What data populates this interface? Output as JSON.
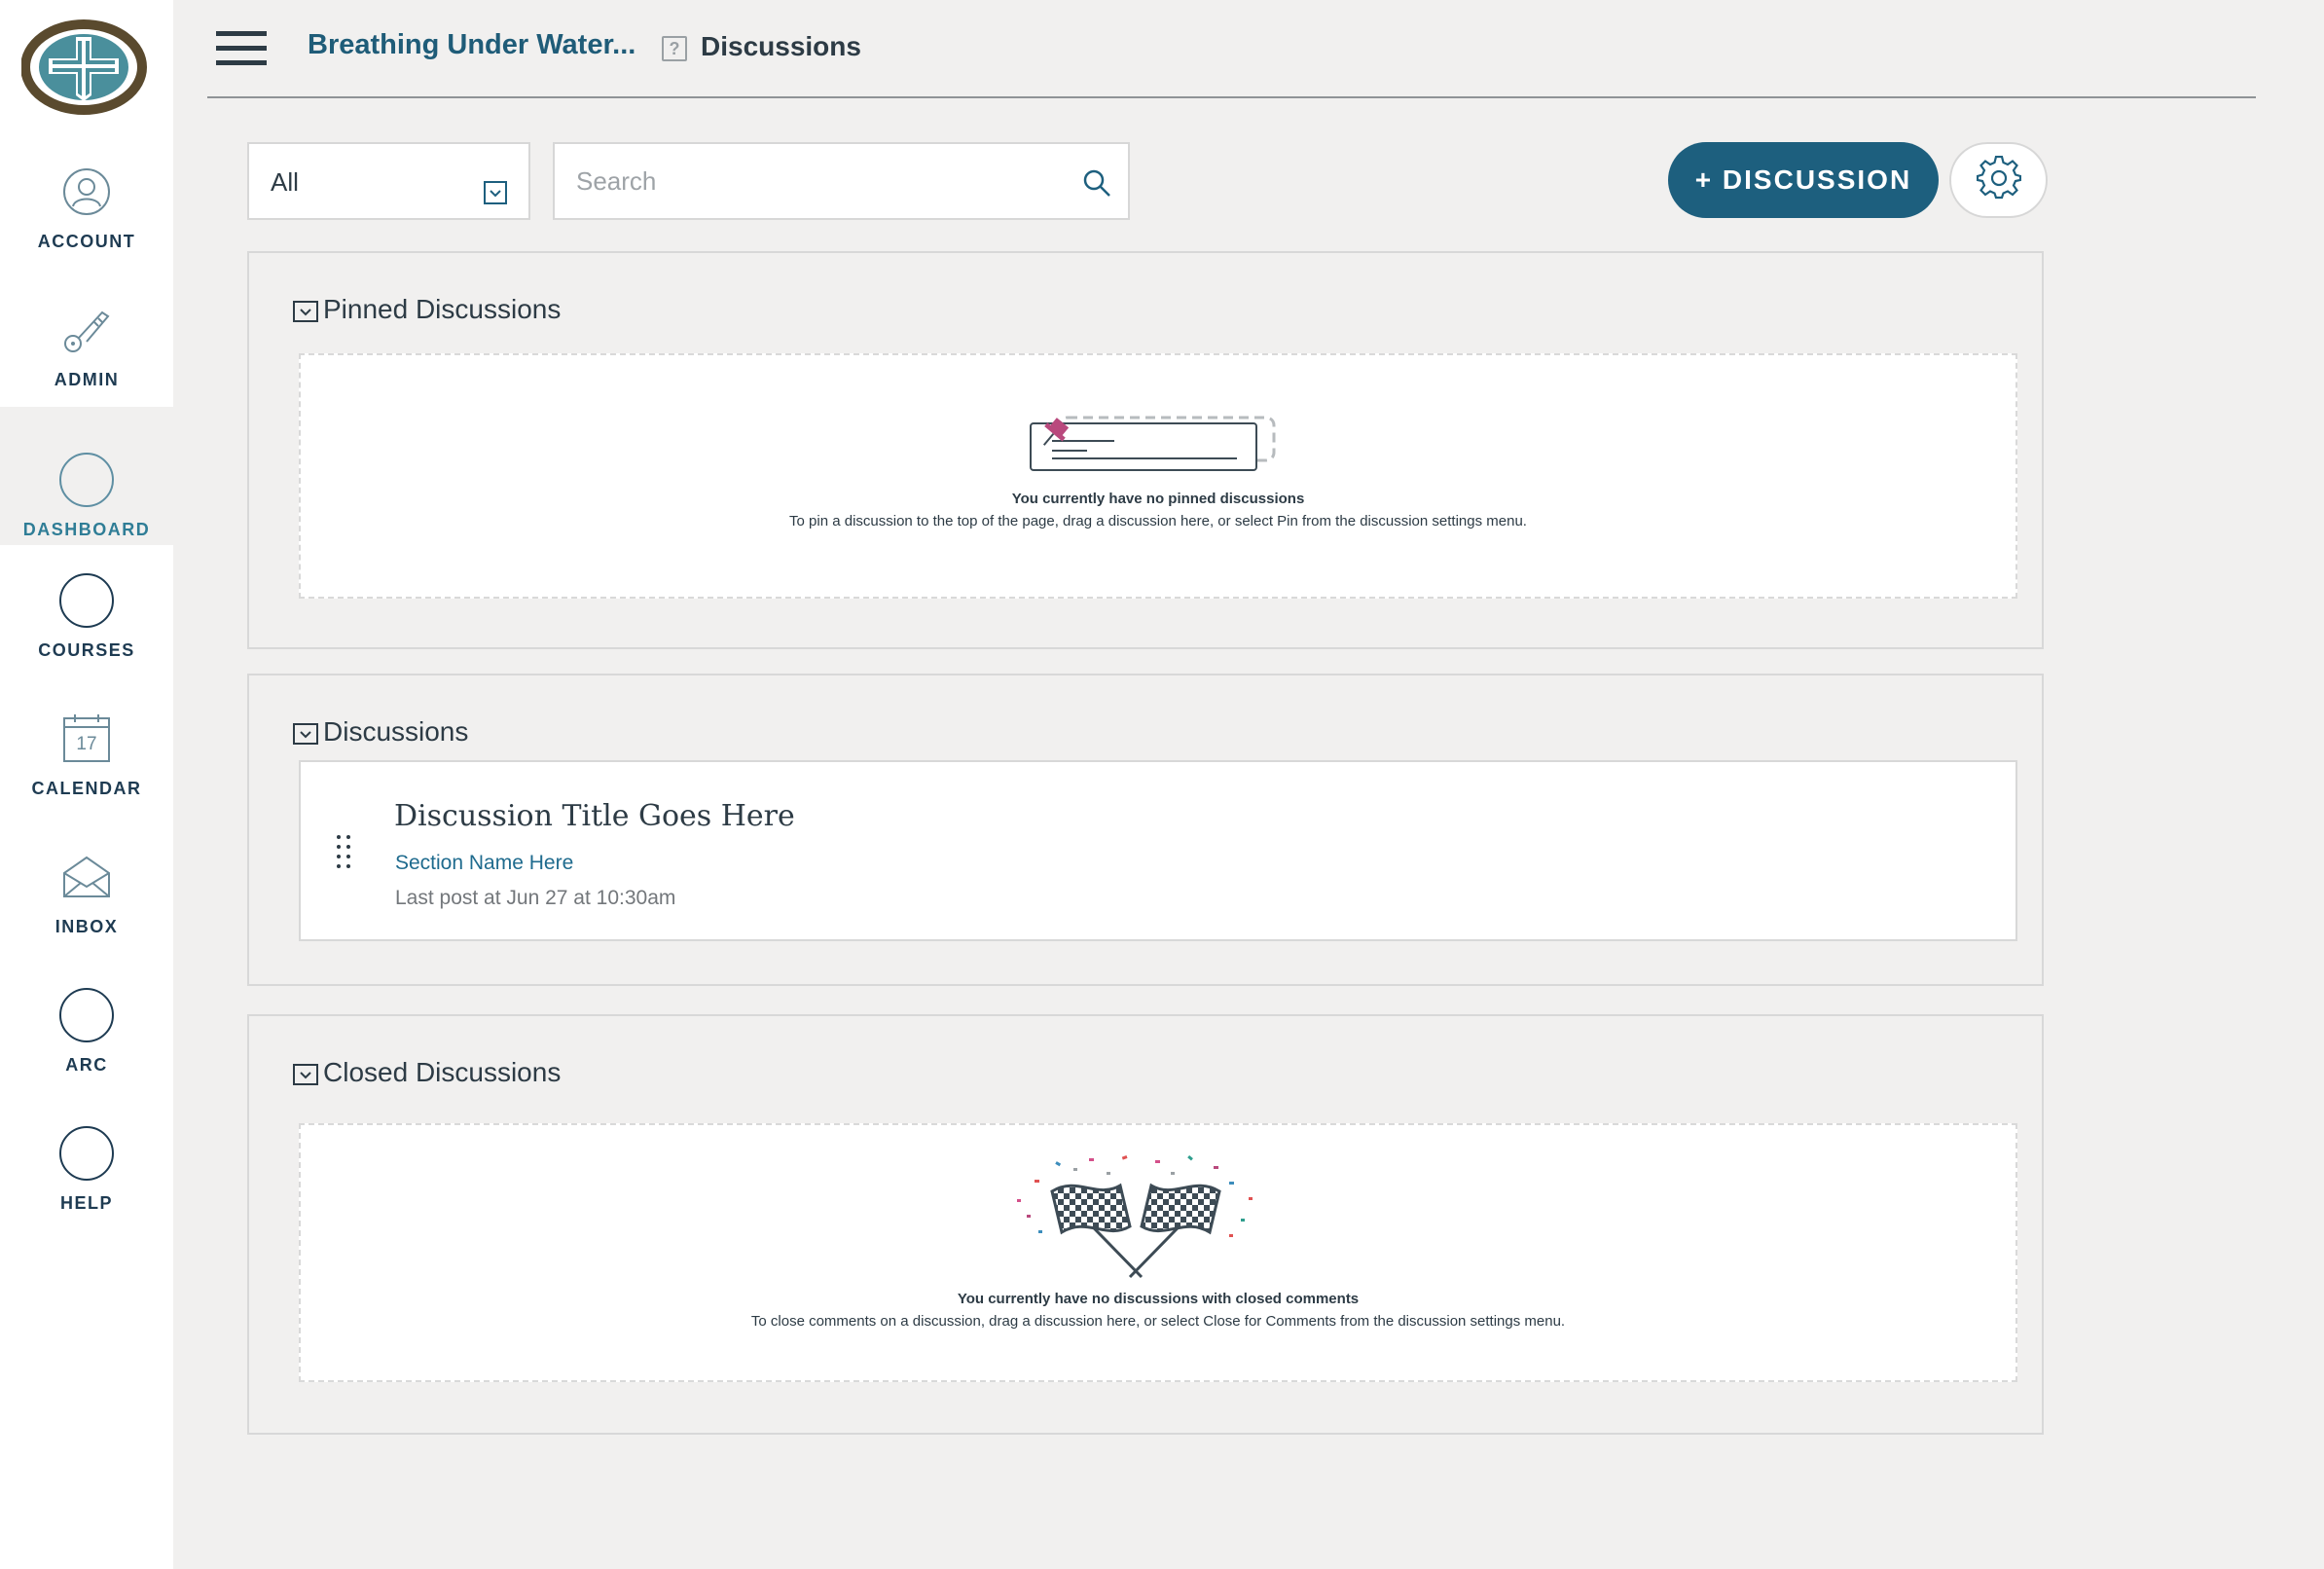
{
  "sidebar": {
    "items": [
      {
        "label": "ACCOUNT",
        "icon": "account-icon"
      },
      {
        "label": "ADMIN",
        "icon": "key-icon"
      },
      {
        "label": "DASHBOARD",
        "icon": "dashboard-icon",
        "active": true
      },
      {
        "label": "COURSES",
        "icon": "courses-icon"
      },
      {
        "label": "CALENDAR",
        "icon": "calendar-icon",
        "day": "17"
      },
      {
        "label": "INBOX",
        "icon": "inbox-icon"
      },
      {
        "label": "ARC",
        "icon": "arc-icon"
      },
      {
        "label": "HELP",
        "icon": "help-icon"
      }
    ]
  },
  "header": {
    "course_title": "Breathing Under Water...",
    "page_title": "Discussions",
    "separator_glyph": "?"
  },
  "toolbar": {
    "filter_value": "All",
    "search_placeholder": "Search",
    "add_button_label": "+ DISCUSSION"
  },
  "pinned": {
    "title": "Pinned Discussions",
    "empty_title": "You currently have no pinned discussions",
    "empty_desc": "To pin a discussion to the top of the page, drag a discussion here, or select Pin from the discussion settings menu."
  },
  "discussions": {
    "title": "Discussions",
    "items": [
      {
        "title": "Discussion Title Goes Here",
        "section": "Section Name Here",
        "last_post": "Last post at Jun 27 at 10:30am"
      }
    ]
  },
  "closed": {
    "title": "Closed Discussions",
    "empty_title": "You currently have no discussions with closed comments",
    "empty_desc": "To close comments on a discussion, drag a discussion here, or select Close for Comments from the discussion settings menu."
  },
  "colors": {
    "brand_dark": "#1d5f7e",
    "link": "#1f6b8e",
    "active_nav": "#2f7d96",
    "logo_brown": "#5a4a2e",
    "logo_teal": "#4a8f9c"
  }
}
